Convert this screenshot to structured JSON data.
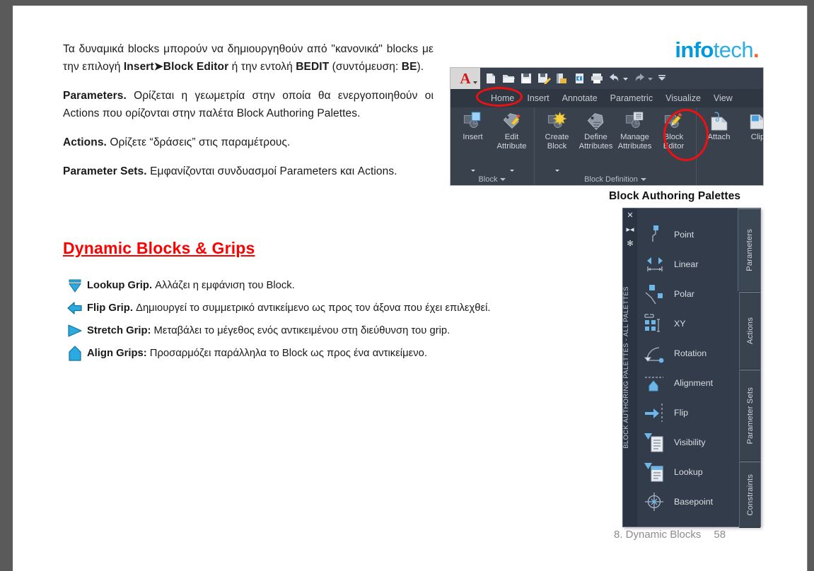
{
  "document": {
    "paragraphs": [
      {
        "runs": [
          {
            "text": "Τα δυναμικά blocks μπορούν να δημιουργηθούν από \"κανονικά\" blocks με την επιλογή ",
            "bold": false
          },
          {
            "text": "Insert➤Block Editor",
            "bold": true
          },
          {
            "text": " ή την εντολή ",
            "bold": false
          },
          {
            "text": "BEDIT",
            "bold": true
          },
          {
            "text": " (συντόμευση: ",
            "bold": false
          },
          {
            "text": "BE",
            "bold": true
          },
          {
            "text": ").",
            "bold": false
          }
        ]
      },
      {
        "runs": [
          {
            "text": "Parameters.",
            "bold": true
          },
          {
            "text": " Ορίζεται η γεωμετρία στην οποία θα ενεργοποιηθούν οι Actions που ορίζονται στην παλέτα Block Authoring Palettes.",
            "bold": false
          }
        ]
      },
      {
        "runs": [
          {
            "text": "Actions.",
            "bold": true
          },
          {
            "text": " Ορίζετε “δράσεις” στις παραμέτρους.",
            "bold": false
          }
        ]
      },
      {
        "runs": [
          {
            "text": "Parameter Sets.",
            "bold": true
          },
          {
            "text": " Εμφανίζονται συνδυασμοί Parameters και Actions.",
            "bold": false
          }
        ]
      }
    ],
    "heading": "Dynamic Blocks & Grips",
    "grips": [
      {
        "icon": "lookup-grip-icon",
        "title": "Lookup Grip.",
        "desc": " Αλλάζει η εμφάνιση του Block."
      },
      {
        "icon": "flip-grip-icon",
        "title": "Flip Grip.",
        "desc": "  Δημιουργεί το συμμετρικό αντικείμενο ως προς τον άξονα που έχει επιλεχθεί."
      },
      {
        "icon": "stretch-grip-icon",
        "title": "Stretch Grip:",
        "desc": " Μεταβάλει το μέγεθος ενός αντικειμένου στη διεύθυνση του grip."
      },
      {
        "icon": "align-grip-icon",
        "title": "Align Grips:",
        "desc": " Προσαρμόζει παράλληλα το Block ως προς ένα αντικείμενο."
      }
    ],
    "footer": {
      "chapter": "8. Dynamic Blocks",
      "page": "58"
    }
  },
  "logo": {
    "part1": "info",
    "part2": "tech",
    "dot": ".",
    "color_primary": "#0099DC",
    "color_secondary": "#29AEE6",
    "color_dot": "#F26522"
  },
  "ribbon": {
    "app_button": "A",
    "quick_access": [
      "new-icon",
      "open-icon",
      "save-icon",
      "save-as-icon",
      "export-icon",
      "import-icon",
      "plot-icon",
      "undo-icon",
      "redo-icon",
      "customize-icon"
    ],
    "tabs": [
      {
        "label": "Home",
        "active": false,
        "highlighted": false
      },
      {
        "label": "Insert",
        "active": true,
        "highlighted": true
      },
      {
        "label": "Annotate",
        "active": false,
        "highlighted": false
      },
      {
        "label": "Parametric",
        "active": false,
        "highlighted": false
      },
      {
        "label": "Visualize",
        "active": false,
        "highlighted": false
      },
      {
        "label": "View",
        "active": false,
        "highlighted": false
      }
    ],
    "panels": [
      {
        "title": "Block",
        "has_dropdown": true,
        "buttons": [
          {
            "label": "Insert",
            "icon": "insert-block-icon",
            "highlighted": false
          },
          {
            "label": "Edit\nAttribute",
            "icon": "edit-attribute-icon",
            "highlighted": false
          }
        ]
      },
      {
        "title": "Block Definition",
        "has_dropdown": true,
        "buttons": [
          {
            "label": "Create\nBlock",
            "icon": "create-block-icon",
            "highlighted": false
          },
          {
            "label": "Define\nAttributes",
            "icon": "define-attributes-icon",
            "highlighted": false
          },
          {
            "label": "Manage\nAttributes",
            "icon": "manage-attributes-icon",
            "highlighted": false
          },
          {
            "label": "Block\nEditor",
            "icon": "block-editor-icon",
            "highlighted": true
          }
        ]
      },
      {
        "title": "",
        "has_dropdown": false,
        "buttons": [
          {
            "label": "Attach",
            "icon": "attach-icon",
            "highlighted": false
          },
          {
            "label": "Clip",
            "icon": "clip-icon",
            "highlighted": false
          }
        ]
      }
    ],
    "highlight_color": "#ee1111"
  },
  "palette": {
    "caption": "Block Authoring Palettes",
    "vertical_title": "BLOCK AUTHORING PALETTES - ALL PALETTES",
    "gutter_icons": [
      "close-icon",
      "auto-hide-icon",
      "properties-icon"
    ],
    "items": [
      {
        "label": "Point",
        "icon": "point-parameter-icon"
      },
      {
        "label": "Linear",
        "icon": "linear-parameter-icon"
      },
      {
        "label": "Polar",
        "icon": "polar-parameter-icon"
      },
      {
        "label": "XY",
        "icon": "xy-parameter-icon"
      },
      {
        "label": "Rotation",
        "icon": "rotation-parameter-icon"
      },
      {
        "label": "Alignment",
        "icon": "alignment-parameter-icon"
      },
      {
        "label": "Flip",
        "icon": "flip-parameter-icon"
      },
      {
        "label": "Visibility",
        "icon": "visibility-parameter-icon"
      },
      {
        "label": "Lookup",
        "icon": "lookup-parameter-icon"
      },
      {
        "label": "Basepoint",
        "icon": "basepoint-parameter-icon"
      }
    ],
    "tabs": [
      {
        "label": "Parameters",
        "selected": true
      },
      {
        "label": "Actions",
        "selected": false
      },
      {
        "label": "Parameter Sets",
        "selected": false
      },
      {
        "label": "Constraints",
        "selected": false
      }
    ]
  }
}
